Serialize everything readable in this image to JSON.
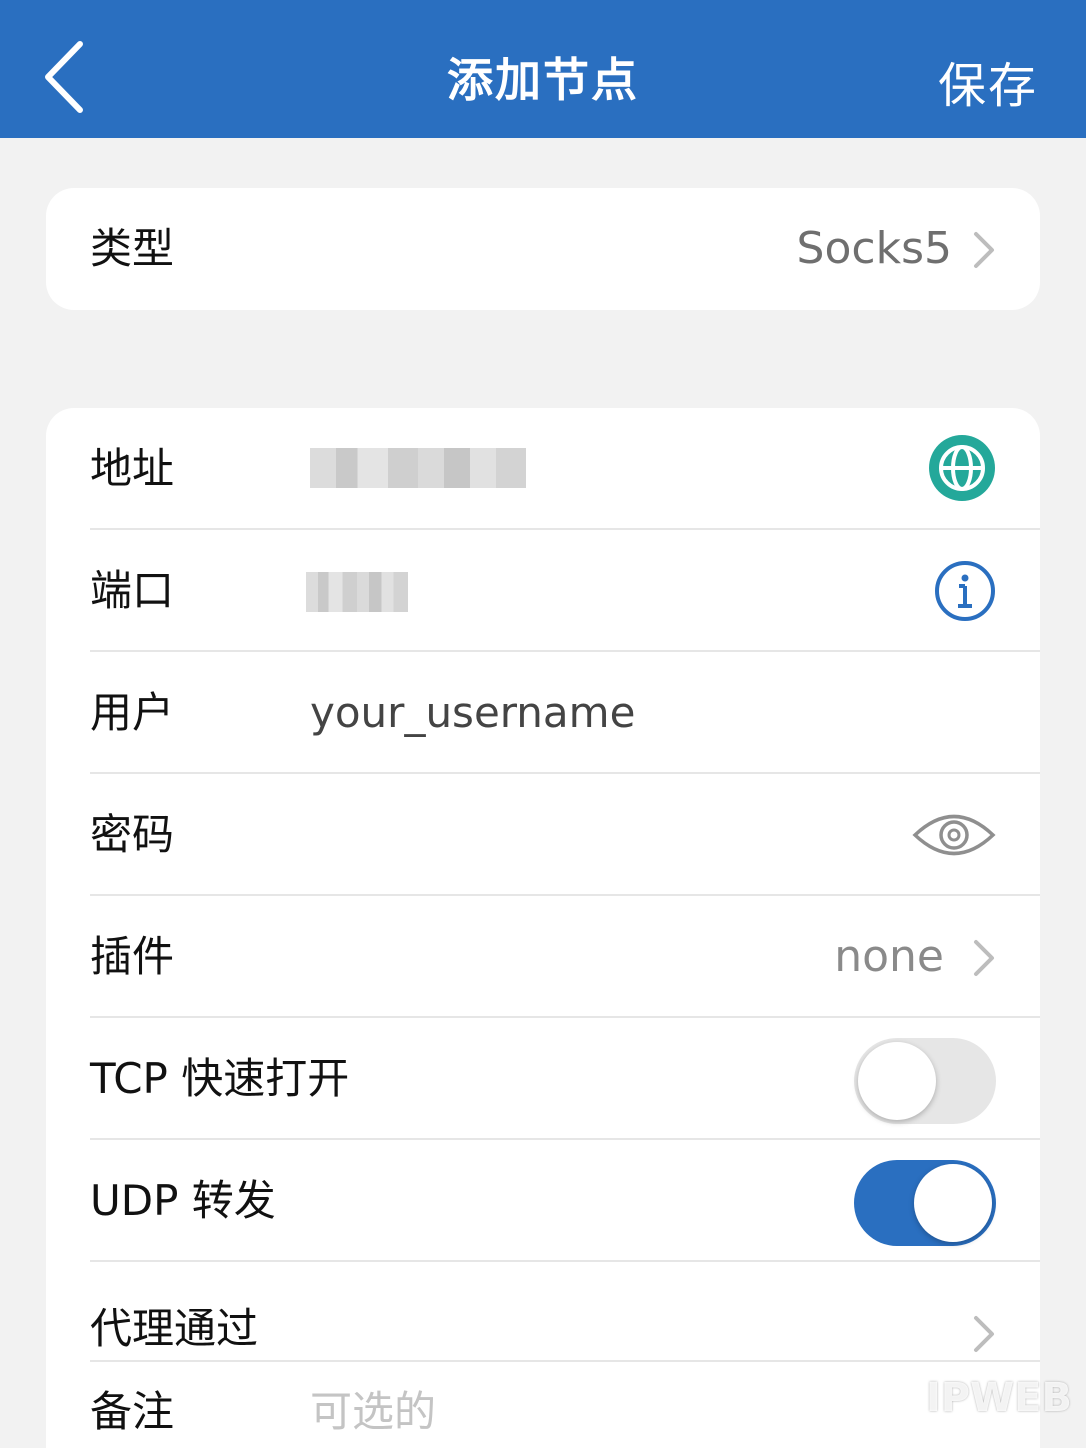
{
  "header": {
    "title": "添加节点",
    "save_label": "保存",
    "back_icon": "chevron-left-icon",
    "background_color": "#2a6fc0"
  },
  "type_row": {
    "label": "类型",
    "value": "Socks5"
  },
  "form": {
    "address": {
      "label": "地址",
      "value_redacted": true,
      "icon": "globe-icon",
      "icon_color": "#24a89a"
    },
    "port": {
      "label": "端口",
      "value_redacted": true,
      "icon": "info-icon",
      "icon_color": "#2a6fc0"
    },
    "user": {
      "label": "用户",
      "value": "your_username"
    },
    "password": {
      "label": "密码",
      "value": "",
      "icon": "eye-icon"
    },
    "plugin": {
      "label": "插件",
      "value": "none"
    },
    "tcp_fast_open": {
      "label": "TCP 快速打开",
      "enabled": false
    },
    "udp_forward": {
      "label": "UDP 转发",
      "enabled": true
    },
    "proxy_via": {
      "label": "代理通过"
    },
    "remark": {
      "label": "备注",
      "placeholder": "可选的"
    }
  },
  "watermark": {
    "text": "IPWEB"
  }
}
